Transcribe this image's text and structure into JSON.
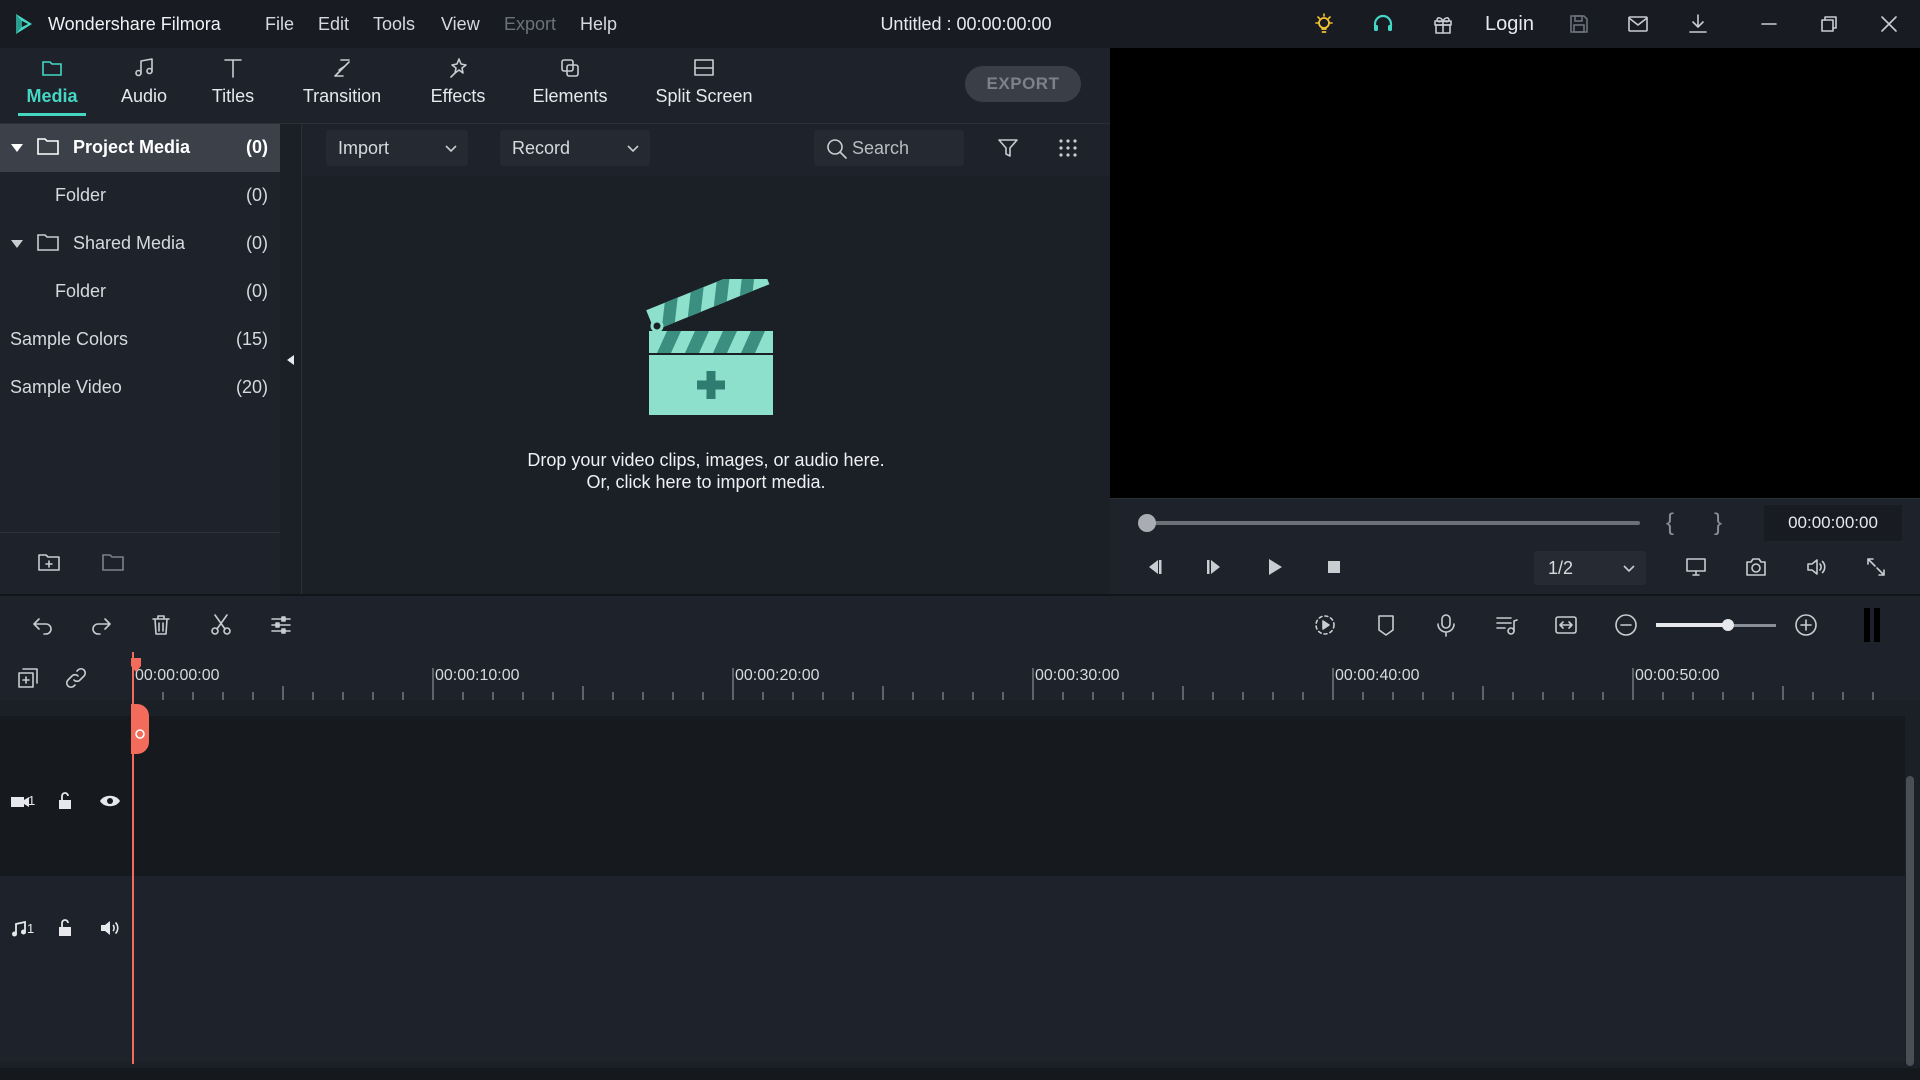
{
  "titlebar": {
    "app_name": "Wondershare Filmora",
    "menu": [
      {
        "label": "File",
        "enabled": true
      },
      {
        "label": "Edit",
        "enabled": true
      },
      {
        "label": "Tools",
        "enabled": true
      },
      {
        "label": "View",
        "enabled": true
      },
      {
        "label": "Export",
        "enabled": false
      },
      {
        "label": "Help",
        "enabled": true
      }
    ],
    "document_title": "Untitled : 00:00:00:00",
    "login_label": "Login",
    "icons": [
      "bulb-icon",
      "headset-icon",
      "gift-icon",
      "save-icon",
      "mail-icon",
      "download-icon",
      "minimize-icon",
      "restore-icon",
      "close-icon"
    ]
  },
  "tabs": [
    {
      "label": "Media",
      "icon": "folder-icon",
      "active": true
    },
    {
      "label": "Audio",
      "icon": "music-note-icon",
      "active": false
    },
    {
      "label": "Titles",
      "icon": "text-t-icon",
      "active": false
    },
    {
      "label": "Transition",
      "icon": "transition-icon",
      "active": false
    },
    {
      "label": "Effects",
      "icon": "sparkle-icon",
      "active": false
    },
    {
      "label": "Elements",
      "icon": "elements-icon",
      "active": false
    },
    {
      "label": "Split Screen",
      "icon": "split-screen-icon",
      "active": false
    }
  ],
  "export_button": "EXPORT",
  "sidebar": {
    "items": [
      {
        "label": "Project Media",
        "count": "(0)",
        "expandable": true,
        "folder_icon": true,
        "selected": true
      },
      {
        "label": "Folder",
        "count": "(0)",
        "expandable": false,
        "folder_icon": false,
        "selected": false
      },
      {
        "label": "Shared Media",
        "count": "(0)",
        "expandable": true,
        "folder_icon": true,
        "selected": false
      },
      {
        "label": "Folder",
        "count": "(0)",
        "expandable": false,
        "folder_icon": false,
        "selected": false
      },
      {
        "label": "Sample Colors",
        "count": "(15)",
        "expandable": false,
        "folder_icon": false,
        "selected": false
      },
      {
        "label": "Sample Video",
        "count": "(20)",
        "expandable": false,
        "folder_icon": false,
        "selected": false
      }
    ]
  },
  "media_toolbar": {
    "import_label": "Import",
    "record_label": "Record",
    "search_placeholder": "Search"
  },
  "media_panel": {
    "drop_line_1": "Drop your video clips, images, or audio here.",
    "drop_line_2": "Or, click here to import media."
  },
  "preview": {
    "timecode": "00:00:00:00",
    "brace_open": "{",
    "brace_close": "}",
    "ratio": "1/2",
    "progress": 0
  },
  "timeline": {
    "ruler_labels": [
      "00:00:00:00",
      "00:00:10:00",
      "00:00:20:00",
      "00:00:30:00",
      "00:00:40:00",
      "00:00:50:00"
    ],
    "video_track_label": "1",
    "audio_track_label": "1",
    "zoom_level": 0.6
  },
  "colors": {
    "accent": "#45d6c4",
    "playhead": "#f26b5b",
    "bulb": "#f2c230",
    "headset": "#45d6c4"
  }
}
